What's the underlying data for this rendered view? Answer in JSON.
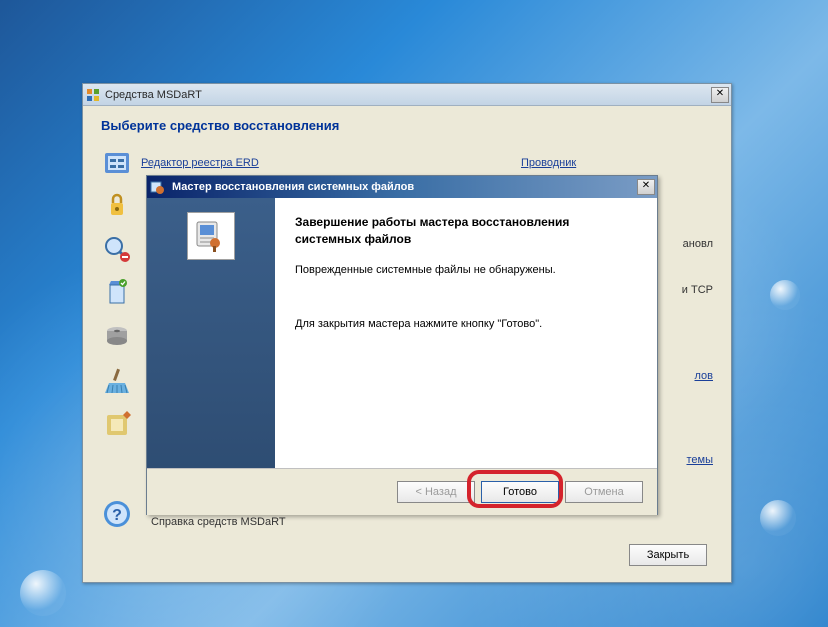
{
  "parent_window": {
    "title": "Средства MSDaRT",
    "section_title": "Выберите средство восстановления",
    "tools": {
      "erd": "Редактор реестра ERD",
      "explorer": "Проводник"
    },
    "partial_right": {
      "text1": "ановл",
      "text2": "и TCP",
      "text3": "лов",
      "text4": "темы"
    },
    "help": {
      "link": "Справка",
      "desc": "Справка средств MSDaRT"
    },
    "close_btn": "Закрыть"
  },
  "wizard": {
    "title": "Мастер восстановления системных файлов",
    "heading": "Завершение работы мастера восстановления системных файлов",
    "msg_noissues": "Поврежденные системные файлы не обнаружены.",
    "msg_close": "Для закрытия мастера нажмите кнопку \"Готово\".",
    "buttons": {
      "back": "< Назад",
      "finish": "Готово",
      "cancel": "Отмена"
    }
  }
}
